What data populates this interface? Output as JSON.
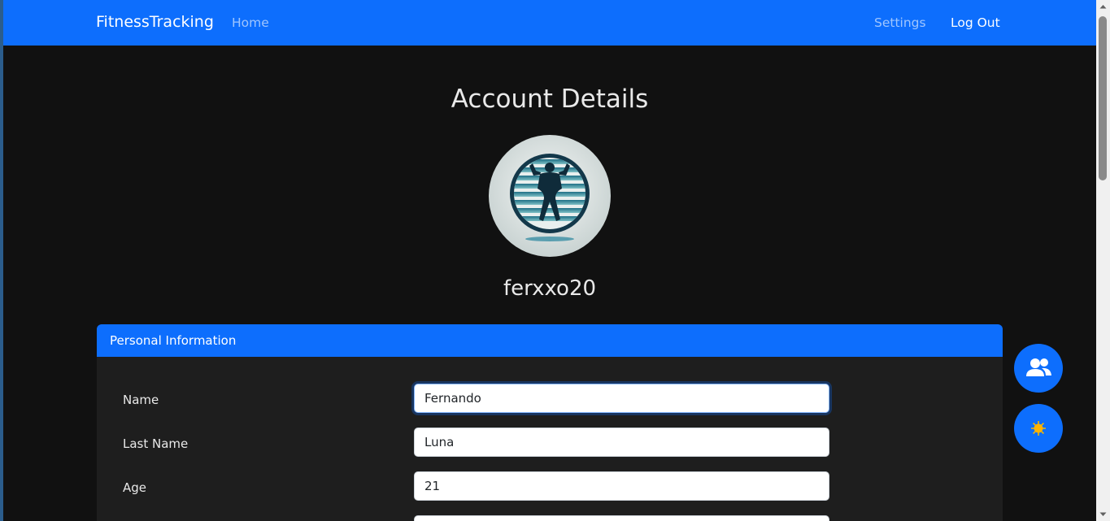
{
  "navbar": {
    "brand": "FitnessTracking",
    "links": {
      "home": "Home",
      "settings": "Settings",
      "logout": "Log Out"
    }
  },
  "page": {
    "title": "Account Details",
    "username": "ferxxo20"
  },
  "card": {
    "header": "Personal Information",
    "fields": [
      {
        "label": "Name",
        "value": "Fernando"
      },
      {
        "label": "Last Name",
        "value": "Luna"
      },
      {
        "label": "Age",
        "value": "21"
      },
      {
        "label": "",
        "value": ""
      }
    ]
  },
  "fabs": [
    {
      "icon": "users-icon"
    },
    {
      "icon": "sun-icon"
    }
  ],
  "colors": {
    "primary": "#0d6efd",
    "background": "#111111",
    "card": "#1e1e1e"
  }
}
